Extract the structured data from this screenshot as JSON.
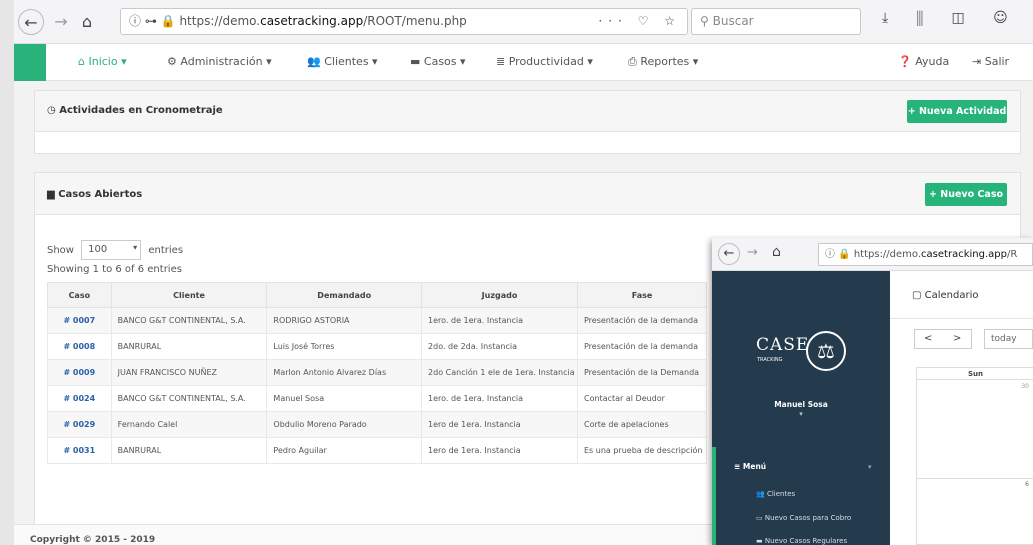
{
  "browser": {
    "url_prefix": "https://demo.",
    "url_host": "casetracking.app",
    "url_path": "/ROOT/menu.php",
    "search_placeholder": "Buscar"
  },
  "nav": {
    "items": [
      "Inicio",
      "Administración",
      "Clientes",
      "Casos",
      "Productividad",
      "Reportes"
    ],
    "help": "Ayuda",
    "logout": "Salir"
  },
  "activities": {
    "title": "Actividades en Cronometraje",
    "new_button": "+ Nueva Actividad"
  },
  "cases": {
    "title": "Casos Abiertos",
    "new_button": "+ Nuevo Caso",
    "show_label": "Show",
    "entries_value": "100",
    "entries_label": "entries",
    "showing": "Showing 1 to 6 of 6 entries",
    "columns": [
      "Caso",
      "Cliente",
      "Demandado",
      "Juzgado",
      "Fase"
    ],
    "rows": [
      [
        "# 0007",
        "BANCO G&T CONTINENTAL, S.A.",
        "RODRIGO ASTORIA",
        "1ero. de 1era. Instancia",
        "Presentación de la demanda"
      ],
      [
        "# 0008",
        "BANRURAL",
        "Luis José Torres",
        "2do. de 2da. Instancia",
        "Presentación de la demanda"
      ],
      [
        "# 0009",
        "JUAN FRANCISCO NUÑEZ",
        "Marlon Antonio Alvarez Días",
        "2do Canción 1 ele de 1era. Instancia",
        "Presentación de la Demanda"
      ],
      [
        "# 0024",
        "BANCO G&T CONTINENTAL, S.A.",
        "Manuel Sosa",
        "1ero. de 1era. Instancia",
        "Contactar al Deudor"
      ],
      [
        "# 0029",
        "Fernando Calel",
        "Obdulio Moreno Parado",
        "1ero de 1era. Instancia",
        "Corte de apelaciones"
      ],
      [
        "# 0031",
        "BANRURAL",
        "Pedro Aguilar",
        "1ero de 1era. Instancia",
        "Es una prueba de descripción"
      ]
    ]
  },
  "footer": {
    "copyright": "Copyright © 2015 - 2019"
  },
  "overlay": {
    "url_prefix": "https://demo.",
    "url_host": "casetracking.app",
    "url_suffix": "/R",
    "logo_line1": "CASE",
    "logo_line2": "TRACKING",
    "user_name": "Manuel Sosa",
    "menu_title": "Menú",
    "menu_items": [
      "Clientes",
      "Nuevo Casos para Cobro",
      "Nuevo Casos Regulares"
    ],
    "calendar_title": "Calendario",
    "today_label": "today",
    "day_header": "Sun",
    "day_num_1": "30",
    "day_num_2": "6"
  },
  "colors": {
    "accent": "#2ab27b",
    "sidebar": "#243a4d",
    "link": "#2a62a8"
  }
}
